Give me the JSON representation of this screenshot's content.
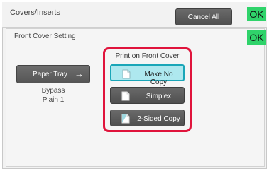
{
  "header": {
    "title": "Covers/Inserts",
    "cancel_label": "Cancel All",
    "ok_label": "OK"
  },
  "section": {
    "title": "Front Cover Setting",
    "ok_label": "OK"
  },
  "paper_tray": {
    "button_label": "Paper Tray",
    "arrow": "→",
    "info_line1": "Bypass",
    "info_line2": "Plain 1"
  },
  "print_options": {
    "label": "Print on Front Cover",
    "options": [
      {
        "label": "Make No Copy",
        "selected": true,
        "icon": "blank-page-icon"
      },
      {
        "label": "Simplex",
        "selected": false,
        "icon": "simplex-page-icon"
      },
      {
        "label": "2-Sided Copy",
        "selected": false,
        "icon": "duplex-page-icon"
      }
    ]
  },
  "colors": {
    "ok_green": "#2fd36a",
    "highlight_red": "#e0143c",
    "selected_fill": "#aee8ef",
    "selected_border": "#1aa6b8",
    "button_dark": "#555555"
  }
}
